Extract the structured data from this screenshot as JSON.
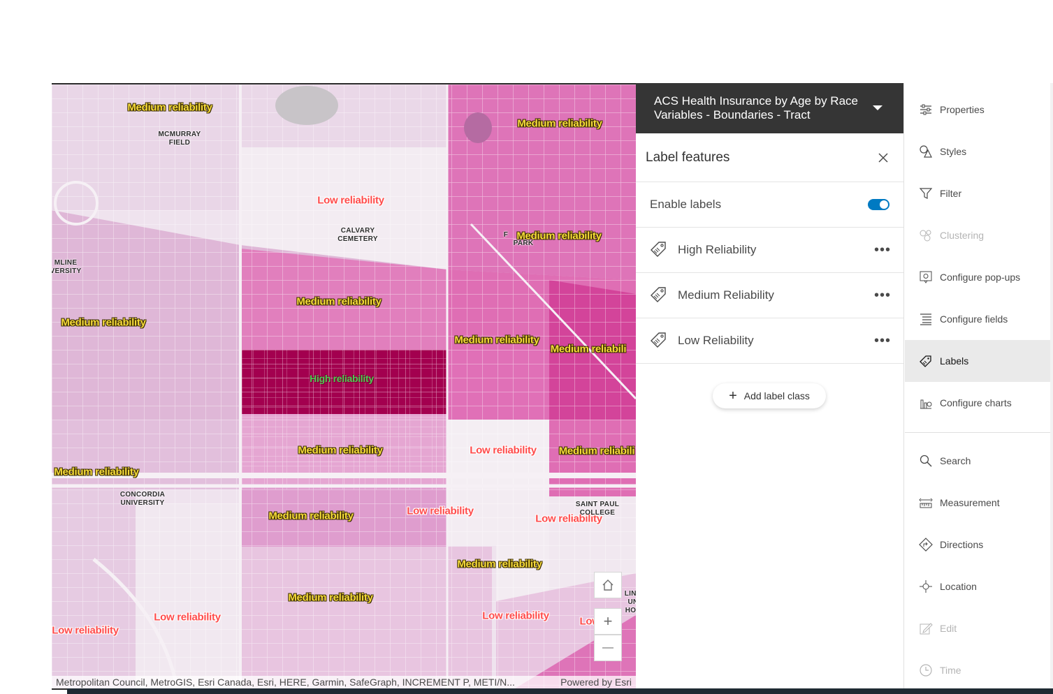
{
  "map": {
    "labels": [
      {
        "text": "Medium reliability",
        "kind": "med"
      },
      {
        "text": "Medium reliability",
        "kind": "med"
      },
      {
        "text": "Low reliability",
        "kind": "low"
      },
      {
        "text": "Medium reliability",
        "kind": "med"
      },
      {
        "text": "Medium reliability",
        "kind": "med"
      },
      {
        "text": "Medium reliability",
        "kind": "med"
      },
      {
        "text": "Medium reliability",
        "kind": "med"
      },
      {
        "text": "Medium reliabili",
        "kind": "med"
      },
      {
        "text": "High reliability",
        "kind": "high"
      },
      {
        "text": "Medium reliability",
        "kind": "med"
      },
      {
        "text": "Low reliability",
        "kind": "low"
      },
      {
        "text": "Medium reliabili",
        "kind": "med"
      },
      {
        "text": "Medium reliability",
        "kind": "med"
      },
      {
        "text": "Medium reliability",
        "kind": "med"
      },
      {
        "text": "Low reliability",
        "kind": "low"
      },
      {
        "text": "Low reliability",
        "kind": "low"
      },
      {
        "text": "Medium reliability",
        "kind": "med"
      },
      {
        "text": "Medium reliability",
        "kind": "med"
      },
      {
        "text": "Low reliability",
        "kind": "low"
      },
      {
        "text": "Low reliability",
        "kind": "low"
      },
      {
        "text": "Low reliability",
        "kind": "low"
      },
      {
        "text": "Low",
        "kind": "low"
      }
    ],
    "pois": [
      {
        "text": "MCMURRAY\nFIELD"
      },
      {
        "text": "CALVARY\nCEMETERY"
      },
      {
        "text": "F"
      },
      {
        "text": "PARK"
      },
      {
        "text": "MLINE\nVERSITY"
      },
      {
        "text": "CONCORDIA\nUNIVERSITY"
      },
      {
        "text": "SAINT PAUL\nCOLLEGE"
      },
      {
        "text": "LINA\nUN\nHOS"
      }
    ],
    "attribution_left": "Metropolitan Council, MetroGIS, Esri Canada, Esri, HERE, Garmin, SafeGraph, INCREMENT P, METI/N...",
    "attribution_right": "Powered by Esri",
    "home_icon": "home-icon",
    "zoom_in": "+",
    "zoom_out": "—"
  },
  "panel": {
    "layer_title": "ACS Health Insurance by Age by Race Variables - Boundaries - Tract",
    "section_title": "Label features",
    "enable_labels": "Enable labels",
    "enable_labels_on": true,
    "classes": [
      {
        "name": "High Reliability"
      },
      {
        "name": "Medium Reliability"
      },
      {
        "name": "Low Reliability"
      }
    ],
    "more_label": "•••",
    "add_label_class": "Add label class"
  },
  "rail": {
    "items": [
      {
        "label": "Properties",
        "icon": "sliders-icon",
        "state": "normal"
      },
      {
        "label": "Styles",
        "icon": "shapes-icon",
        "state": "normal"
      },
      {
        "label": "Filter",
        "icon": "filter-icon",
        "state": "normal"
      },
      {
        "label": "Clustering",
        "icon": "cluster-icon",
        "state": "disabled"
      },
      {
        "label": "Configure pop-ups",
        "icon": "popup-icon",
        "state": "normal"
      },
      {
        "label": "Configure fields",
        "icon": "fields-icon",
        "state": "normal"
      },
      {
        "label": "Labels",
        "icon": "label-icon",
        "state": "active"
      },
      {
        "label": "Configure charts",
        "icon": "chart-icon",
        "state": "normal"
      }
    ],
    "tools": [
      {
        "label": "Search",
        "icon": "search-icon",
        "state": "normal"
      },
      {
        "label": "Measurement",
        "icon": "measure-icon",
        "state": "normal"
      },
      {
        "label": "Directions",
        "icon": "directions-icon",
        "state": "normal"
      },
      {
        "label": "Location",
        "icon": "location-icon",
        "state": "normal"
      },
      {
        "label": "Edit",
        "icon": "edit-icon",
        "state": "disabled"
      },
      {
        "label": "Time",
        "icon": "time-icon",
        "state": "disabled"
      }
    ]
  },
  "colors": {
    "toggle_on": "#007ac2",
    "high": "#a3004f",
    "medium_dark": "#e4609f",
    "medium": "#d98fc4",
    "low": "#efe3ee",
    "header_bg": "#353535"
  }
}
